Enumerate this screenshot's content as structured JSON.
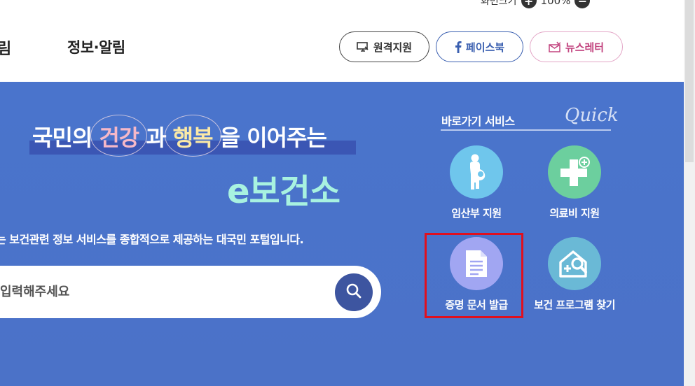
{
  "zoom": {
    "label": "화면크기",
    "value": "100%",
    "increase": "+",
    "decrease": "−"
  },
  "nav": {
    "cut_item": "림",
    "item": "정보·알림"
  },
  "header_buttons": {
    "remote": "원격지원",
    "facebook": "페이스북",
    "newsletter": "뉴스레터"
  },
  "hero": {
    "headline": {
      "part1": "국민의",
      "word1": "건강",
      "part2": "과",
      "word2": "행복",
      "part3": "을 이어주는"
    },
    "brand": "e보건소",
    "tagline": "는 보건관련 정보 서비스를 종합적으로 제공하는 대국민 포털입니다.",
    "search": {
      "placeholder": "입력해주세요"
    }
  },
  "quick": {
    "title": "바로가기 서비스",
    "script": "Quick",
    "items": [
      {
        "label": "임산부 지원",
        "icon": "pregnant-woman-icon"
      },
      {
        "label": "의료비 지원",
        "icon": "medical-cross-icon"
      },
      {
        "label": "증명 문서 발급",
        "icon": "document-icon"
      },
      {
        "label": "보건 프로그램 찾기",
        "icon": "program-search-icon"
      }
    ]
  },
  "colors": {
    "hero_bg": "#4a74cc",
    "brand": "#a8f2e0",
    "highlight": "#e0101e",
    "search_button": "#3d55a0"
  }
}
